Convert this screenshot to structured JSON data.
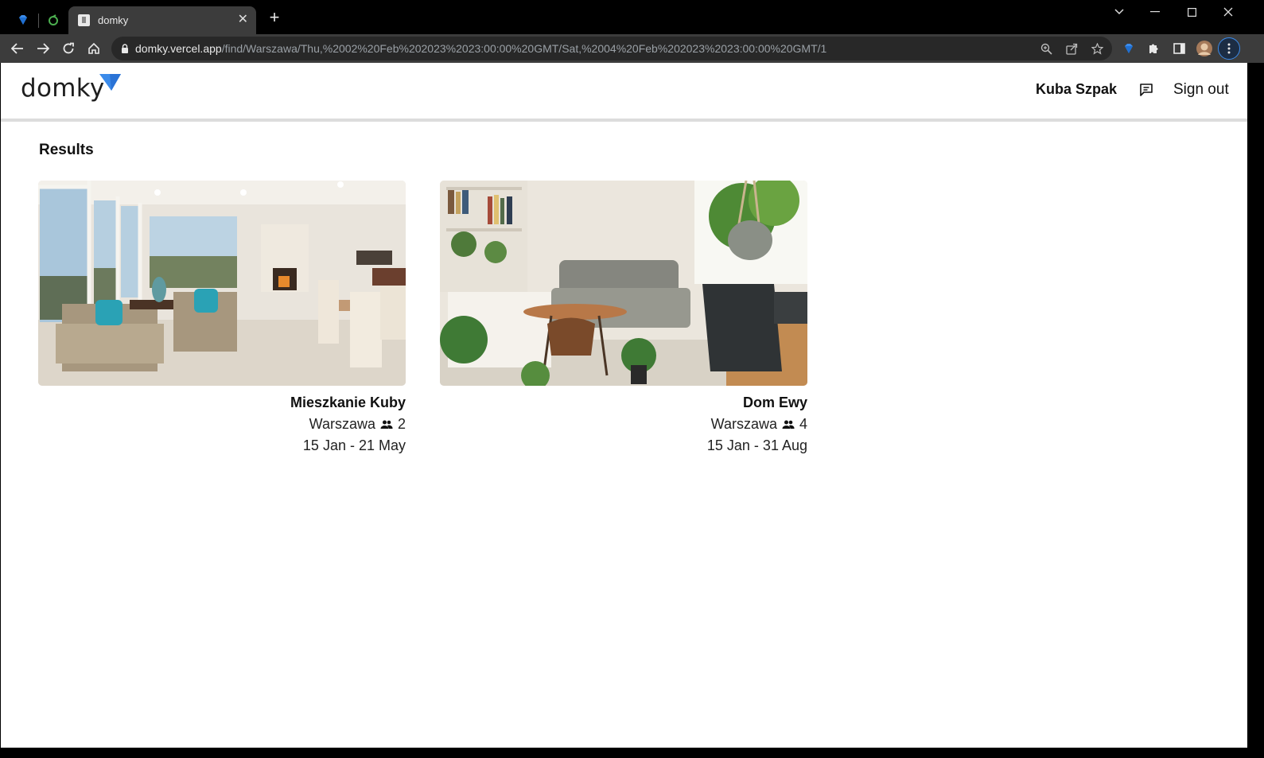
{
  "browser": {
    "tab_title": "domky",
    "url_host": "domky.vercel.app",
    "url_path": "/find/Warszawa/Thu,%2002%20Feb%202023%2023:00:00%20GMT/Sat,%2004%20Feb%202023%2023:00:00%20GMT/1",
    "new_tab_label": "+",
    "close_label": "✕"
  },
  "header": {
    "logo_text": "domky",
    "logo_accent": "#3b8bea",
    "user_name": "Kuba Szpak",
    "sign_out_label": "Sign out"
  },
  "main": {
    "results_title": "Results",
    "listings": [
      {
        "name": "Mieszkanie Kuby",
        "city": "Warszawa",
        "guests": "2",
        "dates": "15 Jan - 21 May",
        "image": "living-room-photo"
      },
      {
        "name": "Dom Ewy",
        "city": "Warszawa",
        "guests": "4",
        "dates": "15 Jan - 31 Aug",
        "image": "living-room-plants-photo"
      }
    ]
  }
}
